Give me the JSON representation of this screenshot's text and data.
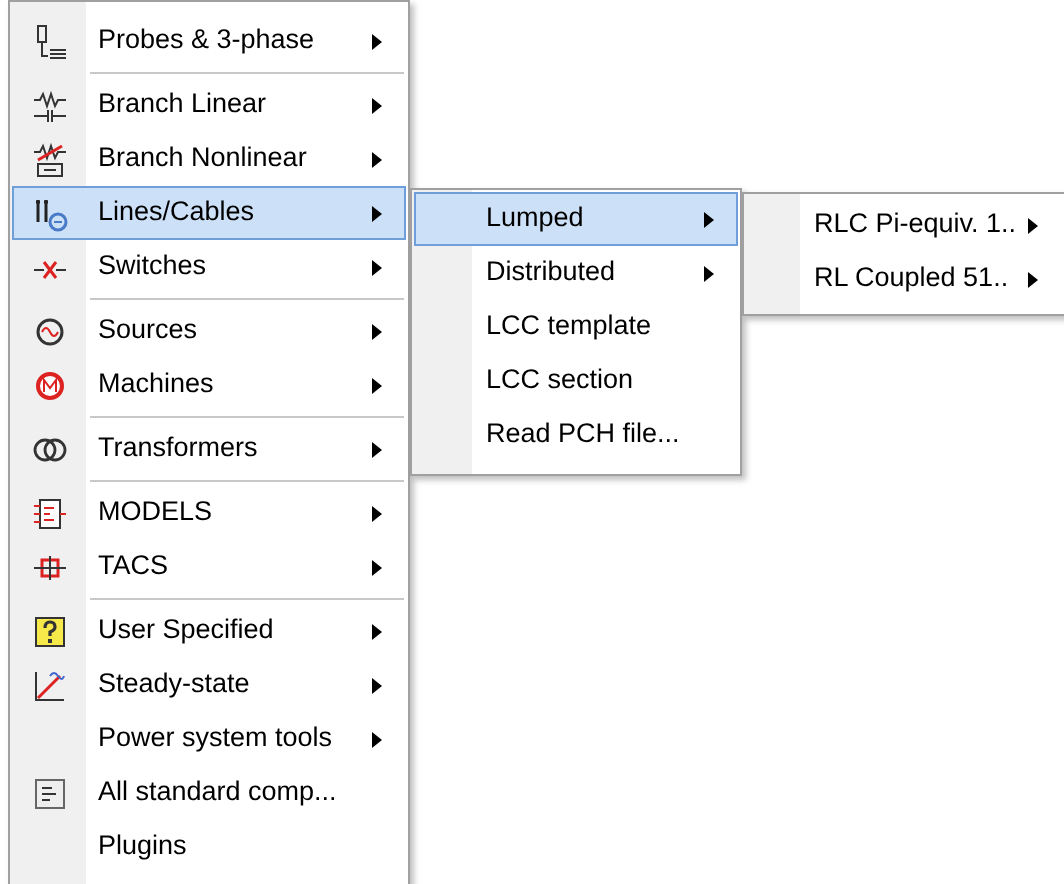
{
  "main_menu": {
    "groups": [
      [
        {
          "label": "Probes & 3-phase",
          "submenu": true,
          "selected": false
        }
      ],
      [
        {
          "label": "Branch Linear",
          "submenu": true,
          "selected": false
        },
        {
          "label": "Branch Nonlinear",
          "submenu": true,
          "selected": false
        },
        {
          "label": "Lines/Cables",
          "submenu": true,
          "selected": true
        },
        {
          "label": "Switches",
          "submenu": true,
          "selected": false
        }
      ],
      [
        {
          "label": "Sources",
          "submenu": true,
          "selected": false
        },
        {
          "label": "Machines",
          "submenu": true,
          "selected": false
        }
      ],
      [
        {
          "label": "Transformers",
          "submenu": true,
          "selected": false
        }
      ],
      [
        {
          "label": "MODELS",
          "submenu": true,
          "selected": false
        },
        {
          "label": "TACS",
          "submenu": true,
          "selected": false
        }
      ],
      [
        {
          "label": "User Specified",
          "submenu": true,
          "selected": false
        },
        {
          "label": "Steady-state",
          "submenu": true,
          "selected": false
        },
        {
          "label": "Power system tools",
          "submenu": true,
          "selected": false
        },
        {
          "label": "All standard comp...",
          "submenu": false,
          "selected": false
        },
        {
          "label": "Plugins",
          "submenu": false,
          "selected": false
        }
      ]
    ]
  },
  "submenu": {
    "items": [
      {
        "label": "Lumped",
        "submenu": true,
        "selected": true
      },
      {
        "label": "Distributed",
        "submenu": true,
        "selected": false
      },
      {
        "label": "LCC template",
        "submenu": false,
        "selected": false
      },
      {
        "label": "LCC section",
        "submenu": false,
        "selected": false
      },
      {
        "label": "Read PCH file...",
        "submenu": false,
        "selected": false
      }
    ]
  },
  "submenu_2": {
    "items": [
      {
        "label": "RLC Pi-equiv. 1..",
        "submenu": true,
        "selected": false
      },
      {
        "label": "RL Coupled 51..",
        "submenu": true,
        "selected": false
      }
    ]
  }
}
